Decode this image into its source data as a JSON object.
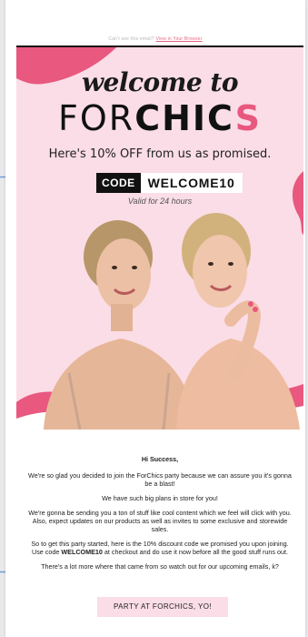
{
  "preheader": {
    "text": "Can't see this email?",
    "link": "View in Your Browser"
  },
  "hero": {
    "welcome": "welcome to",
    "brand_part1": "FOR",
    "brand_part2": "CHIC",
    "brand_part3": "S",
    "offer": "Here's 10% OFF from us as promised.",
    "code_label": "CODE",
    "code_value": "WELCOME10",
    "valid": "Valid for 24 hours"
  },
  "body": {
    "greeting": "Hi Success,",
    "p1": "We're so glad you decided to join the ForChics party because we can assure you it's gonna be a blast!",
    "p2": "We have such big plans in store for you!",
    "p3": "We're gonna be sending you a ton of stuff like cool content which we feel will click with you. Also, expect updates on our products as well as invites to some exclusive and storewide sales.",
    "p4_before": "So to get this party started, here is the 10% discount code we promised you upon joining. Use code ",
    "p4_code": "WELCOME10",
    "p4_after": " at checkout and do use it now before all the good stuff runs out.",
    "p5": "There's a lot more where that came from so watch out for our upcoming emails, k?"
  },
  "cta": {
    "label": "PARTY AT FORCHICS, YO!"
  },
  "colors": {
    "brand_pink": "#e8587f",
    "hero_bg": "#fadde6",
    "accent_dash": "#6b9fd6"
  }
}
